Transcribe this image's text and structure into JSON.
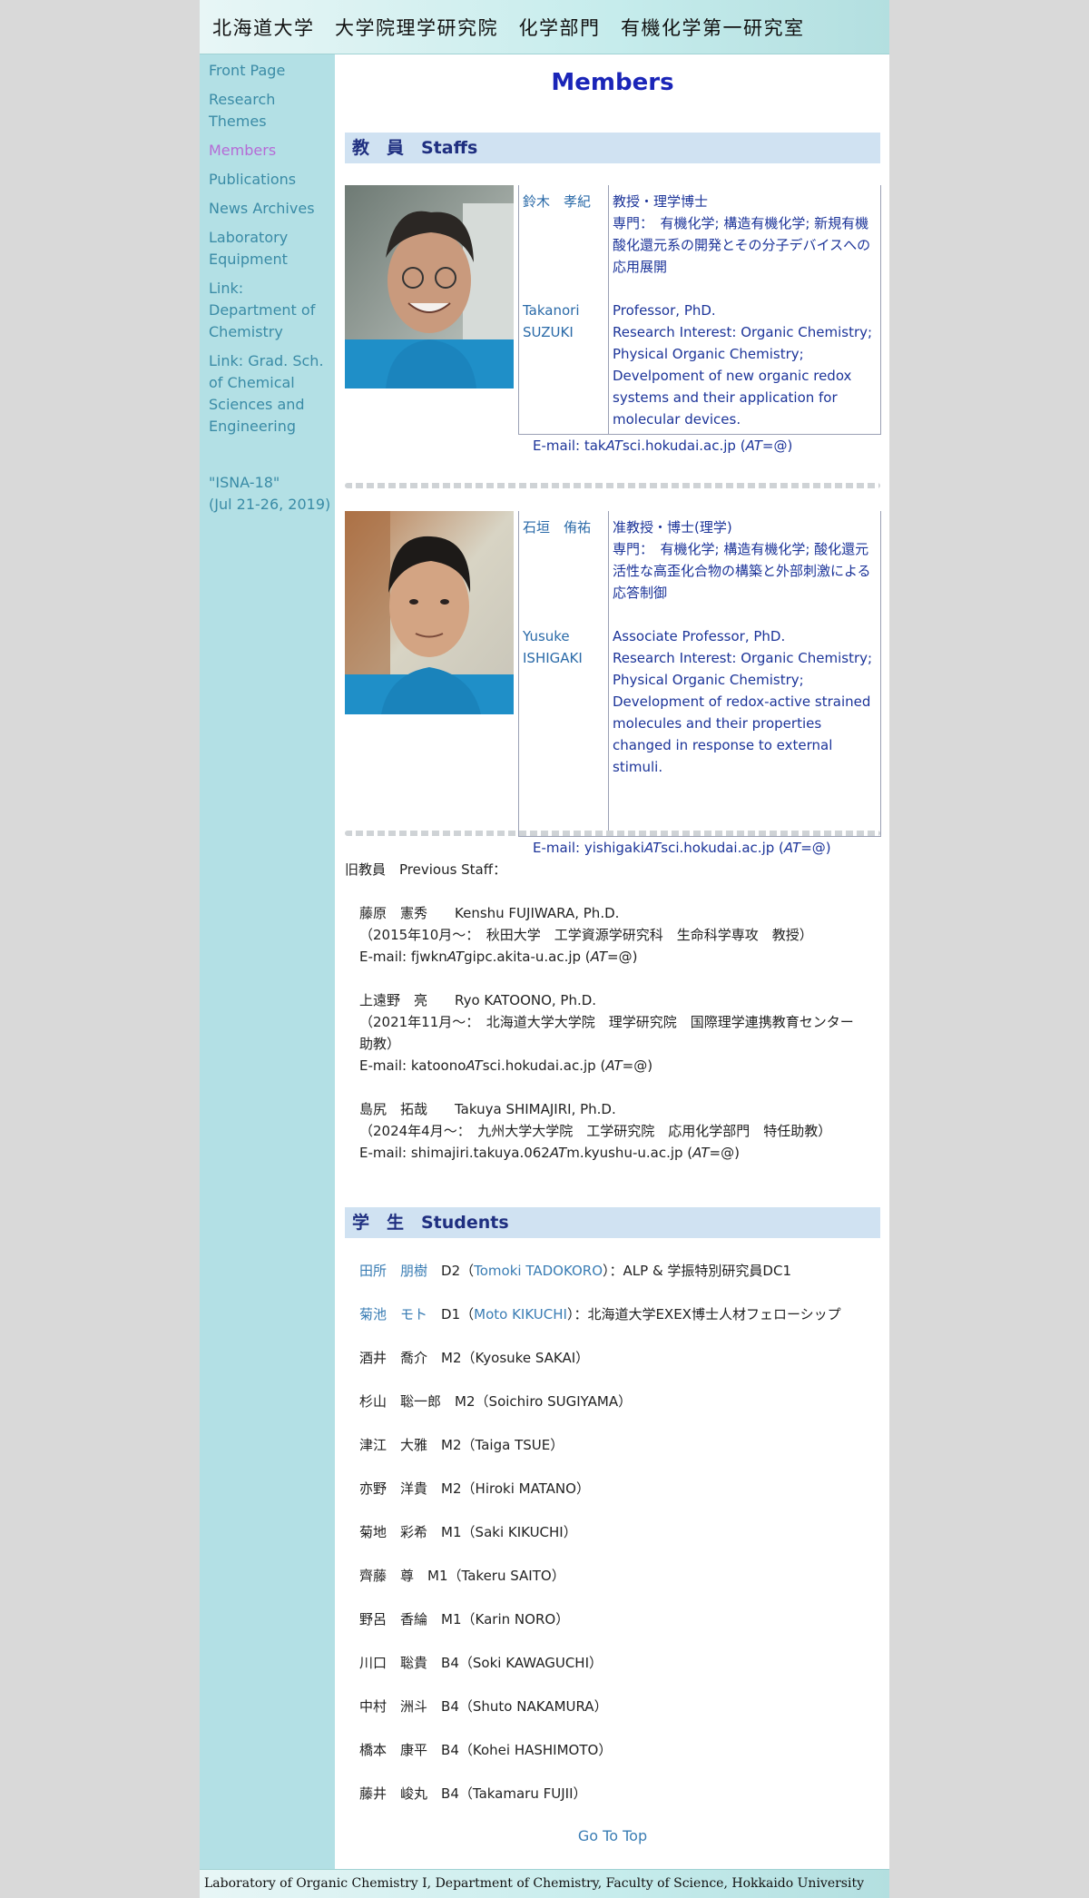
{
  "header": {
    "title": "北海道大学　大学院理学研究院　化学部門　有機化学第一研究室"
  },
  "sidebar": {
    "items": [
      {
        "label": "Front Page"
      },
      {
        "label": "Research Themes"
      },
      {
        "label": "Members"
      },
      {
        "label": "Publications"
      },
      {
        "label": "News Archives"
      },
      {
        "label": "Laboratory Equipment"
      },
      {
        "label": "Link: Department of Chemistry"
      },
      {
        "label": "Link: Grad. Sch. of Chemical Sciences and Engineering"
      }
    ],
    "event": {
      "line1": "\"ISNA-18\"",
      "line2": "(Jul 21-26, 2019)"
    }
  },
  "main": {
    "title": "Members",
    "staff_heading": "教　員　Staffs",
    "staff": [
      {
        "name_jp": "鈴木　孝紀",
        "name_en": "Takanori SUZUKI",
        "title_jp": "教授・理学博士",
        "field_jp": "専門：　有機化学; 構造有機化学; 新規有機酸化還元系の開発とその分子デバイスへの応用展開",
        "title_en": "Professor, PhD.",
        "field_en": "Research Interest: Organic Chemistry; Physical Organic Chemistry; Develpoment of new organic redox systems and their application for molecular devices.",
        "email_prefix": "E-mail: tak",
        "email_at": "AT",
        "email_domain": "sci.hokudai.ac.jp (",
        "email_note_at": "AT",
        "email_note_end": "=@)"
      },
      {
        "name_jp": "石垣　侑祐",
        "name_en": "Yusuke ISHIGAKI",
        "title_jp": "准教授・博士(理学)",
        "field_jp": "専門：　有機化学; 構造有機化学; 酸化還元活性な高歪化合物の構築と外部刺激による応答制御",
        "title_en": "Associate Professor, PhD.",
        "field_en": "Research Interest: Organic Chemistry; Physical Organic Chemistry; Development of redox-active strained molecules and their properties changed in response to external stimuli.",
        "email_prefix": "E-mail: yishigaki",
        "email_at": "AT",
        "email_domain": "sci.hokudai.ac.jp (",
        "email_note_at": "AT",
        "email_note_end": "=@)"
      }
    ],
    "previous_heading": "旧教員　Previous Staff：",
    "previous": [
      {
        "name": "藤原　憲秀　　Kenshu FUJIWARA, Ph.D.",
        "position": "（2015年10月～：　秋田大学　工学資源学研究科　生命科学専攻　教授）",
        "email_prefix": "E-mail: fjwkn",
        "email_domain": "gipc.akita-u.ac.jp ("
      },
      {
        "name": "上遠野　亮　　Ryo KATOONO, Ph.D.",
        "position": "（2021年11月～：　北海道大学大学院　理学研究院　国際理学連携教育センター　助教）",
        "email_prefix": "E-mail: katoono",
        "email_domain": "sci.hokudai.ac.jp ("
      },
      {
        "name": "島尻　拓哉　　Takuya SHIMAJIRI, Ph.D.",
        "position": "（2024年4月～：　九州大学大学院　工学研究院　応用化学部門　特任助教）",
        "email_prefix": "E-mail: shimajiri.takuya.062",
        "email_domain": "m.kyushu-u.ac.jp ("
      }
    ],
    "at_word": "AT",
    "at_end": "=@)",
    "students_heading": "学　生　Students",
    "students": [
      {
        "name": "田所　朋樹",
        "grade": "D2",
        "en": "Tomoki TADOKORO",
        "note": "：ALP & 学振特別研究員DC1",
        "linked": true
      },
      {
        "name": "菊池　モト",
        "grade": "D1",
        "en": "Moto KIKUCHI",
        "note": "：北海道大学EXEX博士人材フェローシップ",
        "linked": true
      },
      {
        "name": "酒井　喬介",
        "grade": "M2",
        "en": "Kyosuke SAKAI",
        "note": "",
        "linked": false
      },
      {
        "name": "杉山　聡一郎",
        "grade": "M2",
        "en": "Soichiro SUGIYAMA",
        "note": "",
        "linked": false
      },
      {
        "name": "津江　大雅",
        "grade": "M2",
        "en": "Taiga TSUE",
        "note": "",
        "linked": false
      },
      {
        "name": "亦野　洋貴",
        "grade": "M2",
        "en": "Hiroki MATANO",
        "note": "",
        "linked": false
      },
      {
        "name": "菊地　彩希",
        "grade": "M1",
        "en": "Saki KIKUCHI",
        "note": "",
        "linked": false
      },
      {
        "name": "齊藤　尊",
        "grade": "M1",
        "en": "Takeru SAITO",
        "note": "",
        "linked": false
      },
      {
        "name": "野呂　香綸",
        "grade": "M1",
        "en": "Karin NORO",
        "note": "",
        "linked": false
      },
      {
        "name": "川口　聡貴",
        "grade": "B4",
        "en": "Soki KAWAGUCHI",
        "note": "",
        "linked": false
      },
      {
        "name": "中村　洲斗",
        "grade": "B4",
        "en": "Shuto NAKAMURA",
        "note": "",
        "linked": false
      },
      {
        "name": "橋本　康平",
        "grade": "B4",
        "en": "Kohei HASHIMOTO",
        "note": "",
        "linked": false
      },
      {
        "name": "藤井　峻丸",
        "grade": "B4",
        "en": "Takamaru FUJII",
        "note": "",
        "linked": false
      }
    ],
    "go_top": "Go To Top"
  },
  "footer": {
    "text": "Laboratory of Organic Chemistry I, Department of Chemistry, Faculty of Science, Hokkaido University"
  }
}
